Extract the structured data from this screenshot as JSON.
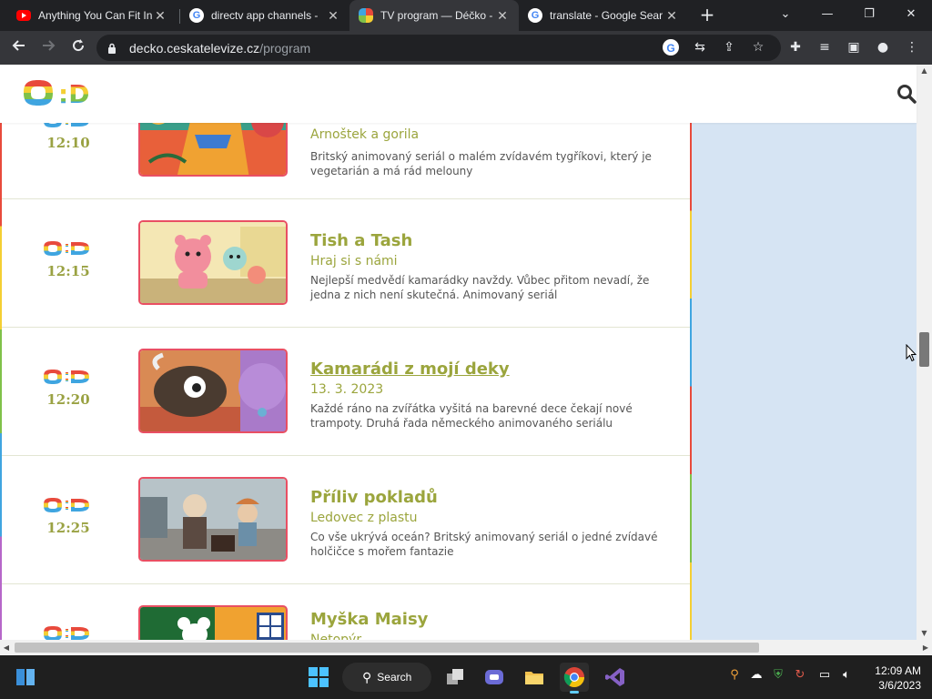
{
  "browser": {
    "tabs": [
      {
        "title": "Anything You Can Fit In",
        "icon": "youtube-icon",
        "active": false
      },
      {
        "title": "directv app channels - ",
        "icon": "google-icon",
        "active": false
      },
      {
        "title": "TV program — Déčko - ",
        "icon": "ct-icon",
        "active": true
      },
      {
        "title": "translate - Google Sear",
        "icon": "google-icon",
        "active": false
      }
    ],
    "url_host": "decko.ceskatelevize.cz",
    "url_path": "/program"
  },
  "site": {
    "logo_text": ":D"
  },
  "programs": [
    {
      "time": "12:10",
      "title": "",
      "subtitle": "Arnoštek a gorila",
      "description": "Britský animovaný seriál o malém zvídavém tygříkovi, který je vegetarián a má rád melouny",
      "is_link": false
    },
    {
      "time": "12:15",
      "title": "Tish a Tash",
      "subtitle": "Hraj si s námi",
      "description": "Nejlepší medvědí kamarádky navždy. Vůbec přitom nevadí, že jedna z nich není skutečná. Animovaný seriál",
      "is_link": false
    },
    {
      "time": "12:20",
      "title": "Kamarádi z mojí deky",
      "subtitle": "13. 3. 2023",
      "description": "Každé ráno na zvířátka vyšitá na barevné dece čekají nové trampoty. Druhá řada německého animovaného seriálu",
      "is_link": true
    },
    {
      "time": "12:25",
      "title": "Příliv pokladů",
      "subtitle": "Ledovec z plastu",
      "description": "Co vše ukrývá oceán? Britský animovaný seriál o jedné zvídavé holčičce s mořem fantazie",
      "is_link": false
    },
    {
      "time": "",
      "title": "Myška Maisy",
      "subtitle": "Netopýr",
      "description": "",
      "is_link": false
    }
  ],
  "taskbar": {
    "search_label": "Search",
    "time": "12:09 AM",
    "date": "3/6/2023"
  }
}
